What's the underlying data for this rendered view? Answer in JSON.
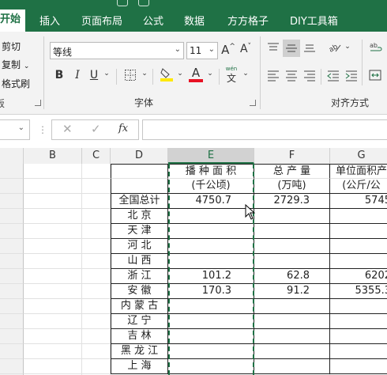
{
  "ribbon_tabs": [
    {
      "label": "开始",
      "active": true
    },
    {
      "label": "插入"
    },
    {
      "label": "页面布局"
    },
    {
      "label": "公式"
    },
    {
      "label": "数据"
    },
    {
      "label": "方方格子"
    },
    {
      "label": "DIY工具箱"
    }
  ],
  "clipboard": {
    "cut": "剪切",
    "copy": "复制",
    "format_painter": "格式刷",
    "group_label_partial": "板"
  },
  "font": {
    "family": "等线",
    "size": "11",
    "group_label": "字体",
    "grow_icon": "A^",
    "shrink_icon": "A˅",
    "bold": "B",
    "italic": "I",
    "underline": "U",
    "font_color_letter": "A",
    "phonetic_top": "wén",
    "phonetic_bottom": "文"
  },
  "alignment": {
    "group_label": "对齐方式"
  },
  "formula_bar": {
    "cancel": "✕",
    "enter": "✓",
    "fx": "fx",
    "value": ""
  },
  "columns": [
    "B",
    "C",
    "D",
    "E",
    "F",
    "G"
  ],
  "table": {
    "headers": {
      "e1": "播 种 面 积",
      "e2": "(千公顷)",
      "f1": "总   产   量",
      "f2": "(万吨)",
      "g1": "单位面积产",
      "g2": "(公斤/公"
    },
    "rows": [
      {
        "region": "全国总计",
        "e": "4750.7",
        "f": "2729.3",
        "g": "5745"
      },
      {
        "region": "北      京",
        "e": "",
        "f": "",
        "g": ""
      },
      {
        "region": "天      津",
        "e": "",
        "f": "",
        "g": ""
      },
      {
        "region": "河      北",
        "e": "",
        "f": "",
        "g": ""
      },
      {
        "region": "山      西",
        "e": "",
        "f": "",
        "g": ""
      },
      {
        "region": "浙      江",
        "e": "101.2",
        "f": "62.8",
        "g": "6202"
      },
      {
        "region": "安      徽",
        "e": "170.3",
        "f": "91.2",
        "g": "5355.3"
      },
      {
        "region": "内 蒙 古",
        "e": "",
        "f": "",
        "g": ""
      },
      {
        "region": "辽      宁",
        "e": "",
        "f": "",
        "g": ""
      },
      {
        "region": "吉      林",
        "e": "",
        "f": "",
        "g": ""
      },
      {
        "region": "黑 龙 江",
        "e": "",
        "f": "",
        "g": ""
      },
      {
        "region": "上      海",
        "e": "",
        "f": "",
        "g": ""
      }
    ]
  },
  "colors": {
    "accent": "#1f7145",
    "marquee": "#1f7145",
    "font_color_bar": "#e81123",
    "highlight_bar": "#ffe900"
  }
}
